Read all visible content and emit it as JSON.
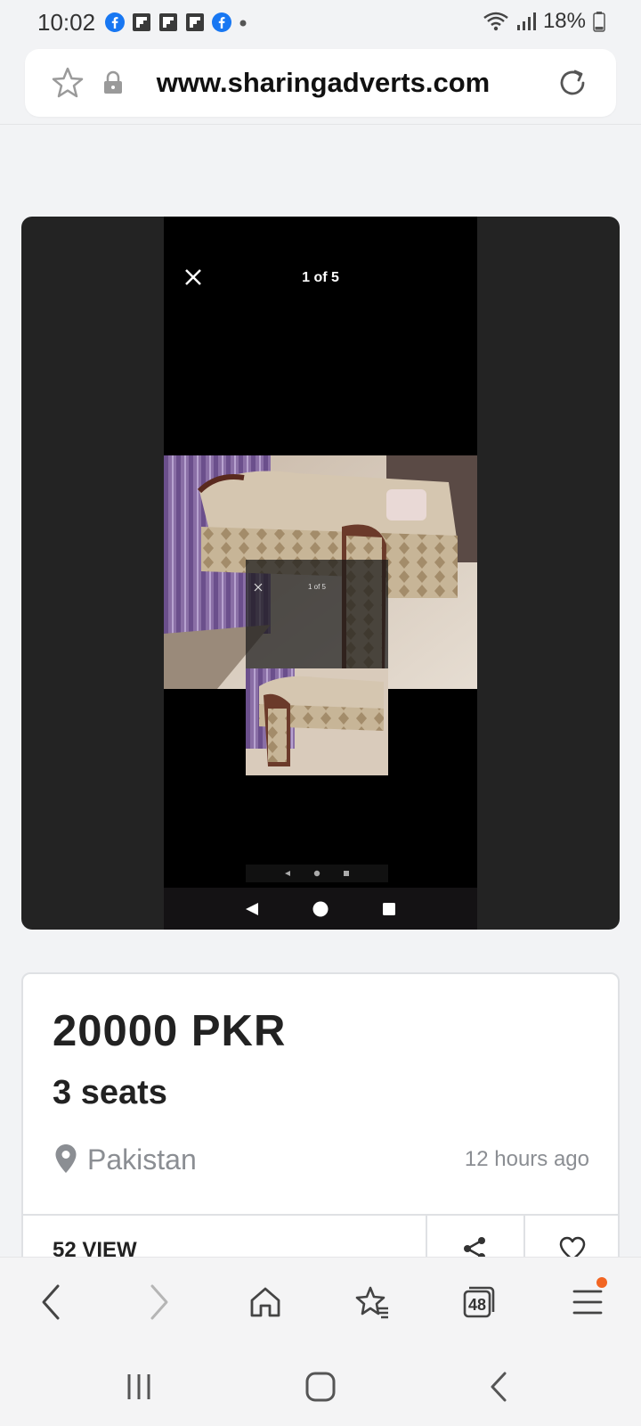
{
  "status_bar": {
    "time": "10:02",
    "notification_icons": [
      "facebook-icon",
      "flipboard-icon",
      "flipboard-icon",
      "flipboard-icon",
      "facebook-icon"
    ],
    "battery_text": "18%"
  },
  "url_bar": {
    "url": "www.sharingadverts.com"
  },
  "gallery": {
    "counter": "1 of 5",
    "nested_counter": "1 of 5"
  },
  "listing": {
    "price": "20000 PKR",
    "title": "3 seats",
    "location": "Pakistan",
    "posted": "12 hours ago",
    "views": "52 VIEW"
  },
  "toolbar": {
    "tabs_count": "48"
  },
  "colors": {
    "accent_notification": "#f26522",
    "facebook_blue": "#1877f2",
    "text_primary": "#222222",
    "text_muted": "#8b8e93"
  }
}
